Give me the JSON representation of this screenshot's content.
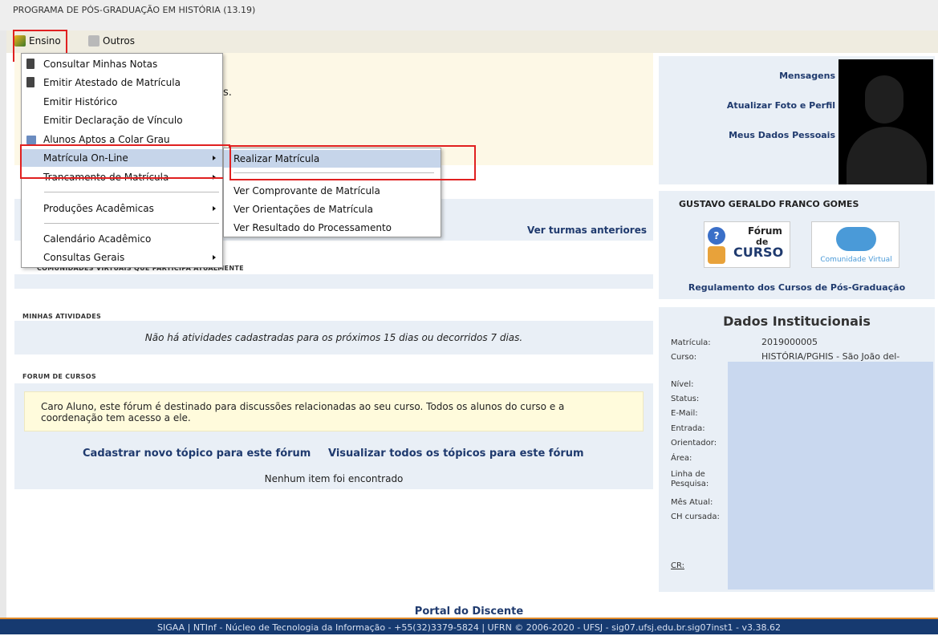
{
  "header": {
    "program_title": "PROGRAMA DE PÓS-GRADUAÇÃO EM HISTÓRIA (13.19)"
  },
  "menubar": {
    "ensino": "Ensino",
    "outros": "Outros"
  },
  "ensino_menu": [
    "Consultar Minhas Notas",
    "Emitir Atestado de Matrícula",
    "Emitir Histórico",
    "Emitir Declaração de Vínculo",
    "Alunos Aptos a Colar Grau",
    "Matrícula On-Line",
    "Trancamento de Matrícula",
    "Produções Acadêmicas",
    "Calendário Acadêmico",
    "Consultas Gerais"
  ],
  "matricula_submenu": [
    "Realizar Matrícula",
    "Ver Comprovante de Matrícula",
    "Ver Orientações de Matrícula",
    "Ver Resultado do Processamento"
  ],
  "main": {
    "partial_text": "s.",
    "ver_turmas": "Ver turmas anteriores",
    "comunidades_label": "Comunidades virtuais que participa atualmente",
    "atividades_label": "Minhas atividades",
    "atividades_msg": "Não há atividades cadastradas para os próximos 15 dias ou decorridos 7 dias.",
    "forum_label": "Forum de Cursos",
    "forum_msg": "Caro Aluno, este fórum é destinado para discussões relacionadas ao seu curso. Todos os alunos do curso e a coordenação tem acesso a ele.",
    "cadastrar_link": "Cadastrar novo tópico para este fórum",
    "visualizar_link": "Visualizar todos os tópicos para este fórum",
    "nenhum_item": "Nenhum item foi encontrado"
  },
  "right_panel": {
    "links": [
      "Mensagens",
      "Atualizar Foto e Perfil",
      "Meus Dados Pessoais"
    ],
    "student_name": "GUSTAVO GERALDO FRANCO GOMES",
    "forum_badge": {
      "line1": "Fórum",
      "line2": "de",
      "line3": "CURSO"
    },
    "comunidade_badge": "Comunidade Virtual",
    "regulamento_link": "Regulamento dos Cursos de Pós-Graduação",
    "dados_title": "Dados Institucionais",
    "fields": {
      "matricula_label": "Matrícula:",
      "matricula_value": "2019000005",
      "curso_label": "Curso:",
      "curso_value": "HISTÓRIA/PGHIS - São João del-",
      "nivel_label": "Nível:",
      "status_label": "Status:",
      "email_label": "E-Mail:",
      "entrada_label": "Entrada:",
      "orientador_label": "Orientador:",
      "area_label": "Área:",
      "linha_label_1": "Linha de",
      "linha_label_2": "Pesquisa:",
      "mes_label": "Mês Atual:",
      "ch_label": "CH cursada:",
      "cr_label": "CR:"
    }
  },
  "footer": {
    "portal": "Portal do Discente",
    "bar": "SIGAA | NTInf - Núcleo de Tecnologia da Informação - +55(32)3379-5824 | UFRN © 2006-2020 - UFSJ - sig07.ufsj.edu.br.sig07inst1 - v3.38.62"
  },
  "colors": {
    "accent": "#1f3a6e",
    "highlight": "#e02020",
    "footer_bg": "#163a70"
  }
}
